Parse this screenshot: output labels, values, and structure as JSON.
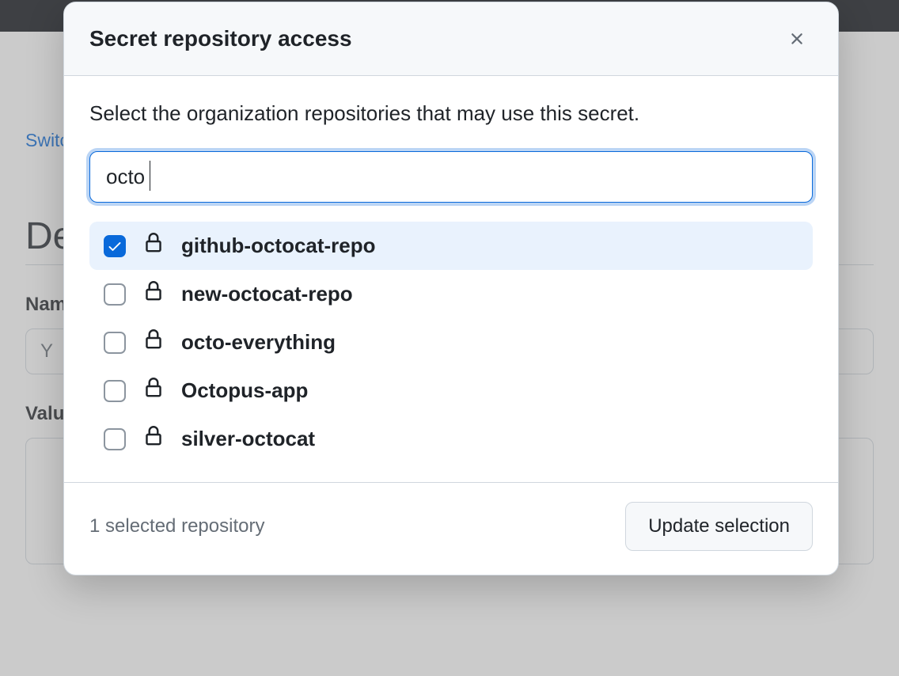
{
  "background": {
    "switch_link": "Switch",
    "page_title": "De",
    "name_label": "Name",
    "name_placeholder": "Y",
    "value_label": "Value"
  },
  "dialog": {
    "title": "Secret repository access",
    "description": "Select the organization repositories that may use this secret.",
    "search_value": "octo",
    "repos": [
      {
        "name": "github-octocat-repo",
        "checked": true
      },
      {
        "name": "new-octocat-repo",
        "checked": false
      },
      {
        "name": "octo-everything",
        "checked": false
      },
      {
        "name": "Octopus-app",
        "checked": false
      },
      {
        "name": "silver-octocat",
        "checked": false
      }
    ],
    "selected_text": "1 selected repository",
    "submit_label": "Update selection"
  }
}
